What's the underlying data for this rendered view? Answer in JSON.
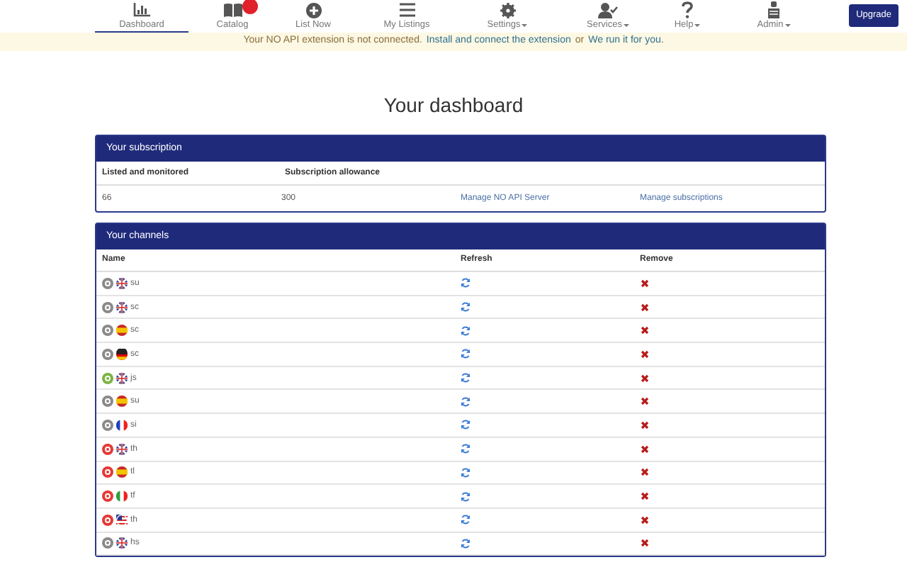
{
  "nav": [
    {
      "label": "Dashboard",
      "selected": true,
      "dropdown": false,
      "badge": false
    },
    {
      "label": "Catalog",
      "selected": false,
      "dropdown": false,
      "badge": true
    },
    {
      "label": "List Now",
      "selected": false,
      "dropdown": false,
      "badge": false
    },
    {
      "label": "My Listings",
      "selected": false,
      "dropdown": false,
      "badge": false
    },
    {
      "label": "Settings",
      "selected": false,
      "dropdown": true,
      "badge": false
    },
    {
      "label": "Services",
      "selected": false,
      "dropdown": true,
      "badge": false
    },
    {
      "label": "Help",
      "selected": false,
      "dropdown": true,
      "badge": false
    },
    {
      "label": "Admin",
      "selected": false,
      "dropdown": true,
      "badge": false
    }
  ],
  "upgrade_button": "Upgrade",
  "banner": {
    "text": "Your NO API extension is not connected.",
    "link1": "Install and connect the extension",
    "middle": "or",
    "link2": "We run it for you."
  },
  "title": "Your dashboard",
  "subscription": {
    "header": "Your subscription",
    "columns": [
      "Listed and monitored",
      "Subscription allowance"
    ],
    "values": [
      "66",
      "300"
    ],
    "links": [
      "Manage NO API Server",
      "Manage subscriptions"
    ]
  },
  "channels": {
    "header": "Your channels",
    "columns": [
      "Name",
      "Refresh",
      "Remove"
    ],
    "rows": [
      {
        "name": "su",
        "color": "#8a8a8a",
        "kind": "uk"
      },
      {
        "name": "sc",
        "color": "#8a8a8a",
        "kind": "uk"
      },
      {
        "name": "sc",
        "color": "#8a8a8a",
        "kind": "es"
      },
      {
        "name": "sc",
        "color": "#8a8a8a",
        "kind": "de"
      },
      {
        "name": "js",
        "color": "#7cb342",
        "kind": "uk"
      },
      {
        "name": "su",
        "color": "#8a8a8a",
        "kind": "es"
      },
      {
        "name": "si",
        "color": "#8a8a8a",
        "kind": "fr"
      },
      {
        "name": "th",
        "color": "#e53935",
        "kind": "uk"
      },
      {
        "name": "tl",
        "color": "#e53935",
        "kind": "es"
      },
      {
        "name": "tf",
        "color": "#e53935",
        "kind": "it"
      },
      {
        "name": "th",
        "color": "#e53935",
        "kind": "us"
      },
      {
        "name": "hs",
        "color": "#8a8a8a",
        "kind": "uk"
      }
    ]
  }
}
